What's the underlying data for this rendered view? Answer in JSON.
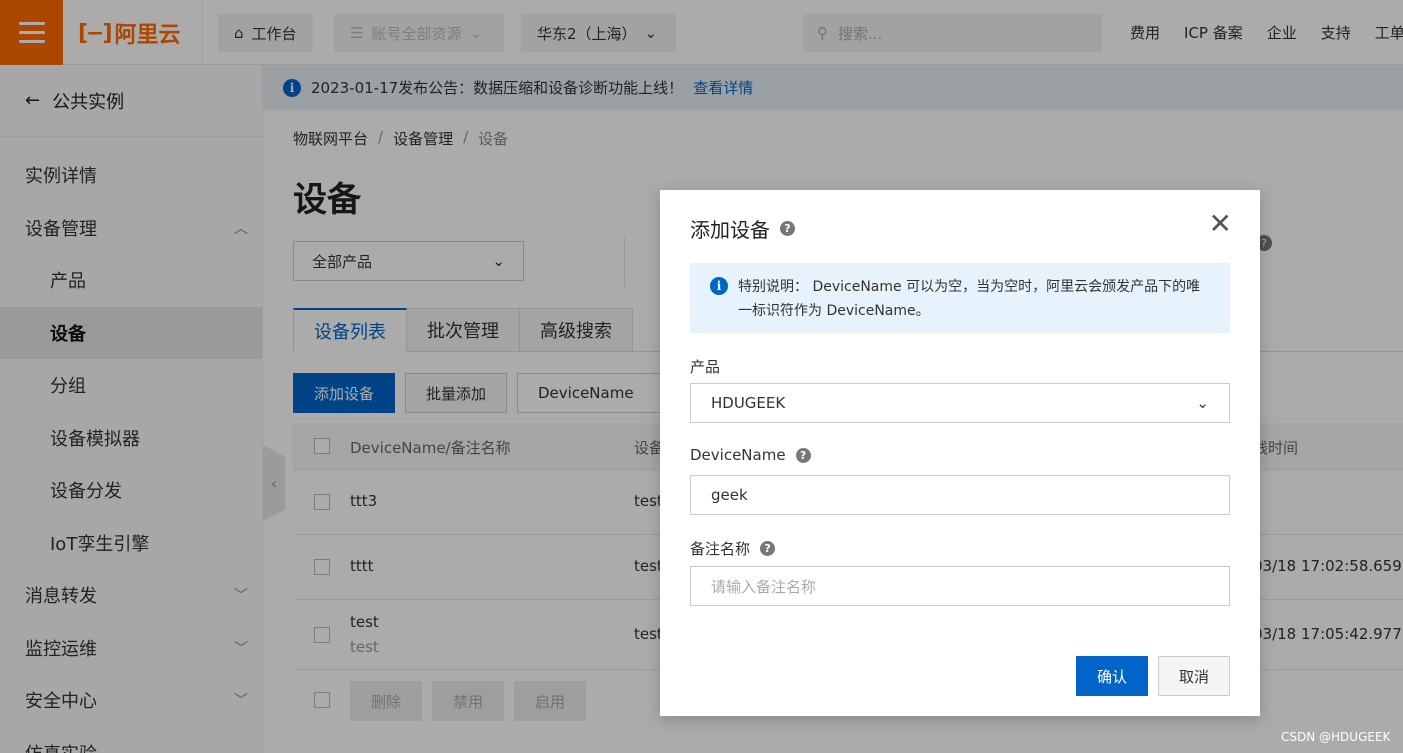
{
  "topbar": {
    "logo_text": "阿里云",
    "workbench": "工作台",
    "resources": "账号全部资源",
    "region": "华东2（上海）",
    "search_placeholder": "搜索...",
    "links": [
      "费用",
      "ICP 备案",
      "企业",
      "支持",
      "工单"
    ]
  },
  "sidebar": {
    "back_label": "公共实例",
    "items": [
      {
        "label": "实例详情"
      },
      {
        "label": "设备管理"
      },
      {
        "label": "产品"
      },
      {
        "label": "设备"
      },
      {
        "label": "分组"
      },
      {
        "label": "设备模拟器"
      },
      {
        "label": "设备分发"
      },
      {
        "label": "IoT孪生引擎"
      },
      {
        "label": "消息转发"
      },
      {
        "label": "监控运维"
      },
      {
        "label": "安全中心"
      },
      {
        "label": "仿真实验"
      }
    ]
  },
  "notice": {
    "text": "2023-01-17发布公告：数据压缩和设备诊断功能上线！",
    "link": "查看详情"
  },
  "breadcrumb": [
    "物联网平台",
    "设备管理",
    "设备"
  ],
  "page_title": "设备",
  "product_filter": "全部产品",
  "tabs": [
    "设备列表",
    "批次管理",
    "高级搜索"
  ],
  "toolbar": {
    "add_device": "添加设备",
    "batch_add": "批量添加",
    "search_field": "DeviceName"
  },
  "table": {
    "headers": [
      "DeviceName/备注名称",
      "设备",
      "线时间"
    ],
    "rows": [
      {
        "name": "ttt3",
        "remark": "",
        "product": "test",
        "time": ""
      },
      {
        "name": "tttt",
        "remark": "",
        "product": "test",
        "time": "03/18 17:02:58.659"
      },
      {
        "name": "test",
        "remark": "test",
        "product": "test",
        "time": "03/18 17:05:42.977"
      }
    ],
    "bulk_actions": [
      "删除",
      "禁用",
      "启用"
    ]
  },
  "dialog": {
    "title": "添加设备",
    "alert": "特别说明： DeviceName 可以为空，当为空时，阿里云会颁发产品下的唯一标识符作为 DeviceName。",
    "product_label": "产品",
    "product_value": "HDUGEEK",
    "devicename_label": "DeviceName",
    "devicename_value": "geek",
    "remark_label": "备注名称",
    "remark_placeholder": "请输入备注名称",
    "ok": "确认",
    "cancel": "取消"
  },
  "watermark": "CSDN @HDUGEEK",
  "colors": {
    "brand": "#ff6a00",
    "primary": "#0064c8"
  }
}
